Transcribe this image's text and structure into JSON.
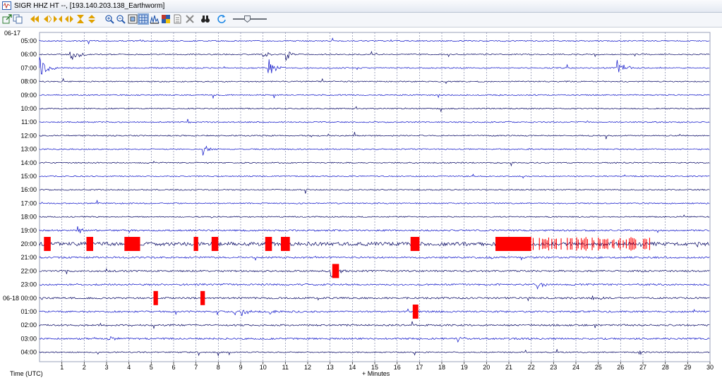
{
  "window": {
    "title": "SIGR HHZ HT --, [193.140.203.138_Earthworm]"
  },
  "toolbar": {
    "buttons": [
      {
        "name": "export-icon",
        "color": "#2e7d32"
      },
      {
        "name": "copy-icon",
        "color": "#4a6fa5"
      },
      {
        "name": "rewind-fast-icon",
        "color": "#e0a100"
      },
      {
        "name": "rewind-icon",
        "color": "#e0a100"
      },
      {
        "name": "shrink-icon",
        "color": "#e0a100"
      },
      {
        "name": "expand-icon",
        "color": "#e0a100"
      },
      {
        "name": "hourglass-icon",
        "color": "#e0a100"
      },
      {
        "name": "vertical-expand-icon",
        "color": "#e0a100"
      },
      {
        "name": "zoom-in-icon",
        "color": "#2a5db0"
      },
      {
        "name": "zoom-out-icon",
        "color": "#2a5db0"
      },
      {
        "name": "fit-page-icon",
        "color": "#444444"
      },
      {
        "name": "grid-view-icon",
        "color": "#2a5db0",
        "active": true
      },
      {
        "name": "spectrum-icon",
        "color": "#2a5db0"
      },
      {
        "name": "color-map-icon",
        "color": "#c0392b"
      },
      {
        "name": "page-icon",
        "color": "#777777"
      },
      {
        "name": "close-icon",
        "color": "#888888"
      },
      {
        "name": "binoculars-icon",
        "color": "#222222"
      },
      {
        "name": "refresh-icon",
        "color": "#1e88e5"
      }
    ],
    "zoom_level": 0.4
  },
  "helicorder": {
    "date_top": "06-17",
    "time_axis_label": "Time (UTC)",
    "minute_axis_label": "+ Minutes",
    "trace_color": "#0a10c8",
    "clip_color": "#ff0000",
    "grid_color": "#7f86a6",
    "hour_labels": [
      "05:00",
      "06:00",
      "07:00",
      "08:00",
      "09:00",
      "10:00",
      "11:00",
      "12:00",
      "13:00",
      "14:00",
      "15:00",
      "16:00",
      "17:00",
      "18:00",
      "19:00",
      "20:00",
      "21:00",
      "22:00",
      "23:00",
      "06-18 00:00",
      "01:00",
      "02:00",
      "03:00",
      "04:00"
    ],
    "minute_ticks": [
      "1",
      "2",
      "3",
      "4",
      "5",
      "6",
      "7",
      "8",
      "9",
      "10",
      "11",
      "12",
      "13",
      "14",
      "15",
      "16",
      "17",
      "18",
      "19",
      "20",
      "21",
      "22",
      "23",
      "24",
      "25",
      "26",
      "27",
      "28",
      "29",
      "30"
    ],
    "events": [
      {
        "row": 1,
        "min": 10.0,
        "amp": 0.5,
        "dur": 0.6
      },
      {
        "row": 2,
        "min": 0.0,
        "amp": 0.9,
        "dur": 0.8
      },
      {
        "row": 1,
        "min": 1.3,
        "amp": 0.9,
        "dur": 0.8
      },
      {
        "row": 2,
        "min": 10.2,
        "amp": 0.9,
        "dur": 0.8
      },
      {
        "row": 1,
        "min": 11.0,
        "amp": 0.6,
        "dur": 0.6
      },
      {
        "row": 2,
        "min": 25.8,
        "amp": 0.8,
        "dur": 0.9
      },
      {
        "row": 0,
        "min": 4.5,
        "amp": 0.15,
        "dur": 0.3
      },
      {
        "row": 8,
        "min": 7.3,
        "amp": 0.6,
        "dur": 0.7
      },
      {
        "row": 14,
        "min": 1.7,
        "amp": 0.5,
        "dur": 0.6
      },
      {
        "row": 6,
        "min": 6.6,
        "amp": 0.3,
        "dur": 0.3
      },
      {
        "row": 17,
        "min": 13.0,
        "amp": 0.7,
        "dur": 0.9
      },
      {
        "row": 18,
        "min": 22.2,
        "amp": 0.6,
        "dur": 0.6
      },
      {
        "row": 19,
        "min": 24.6,
        "amp": 0.3,
        "dur": 0.6
      },
      {
        "row": 20,
        "min": 9.0,
        "amp": 0.5,
        "dur": 0.7
      },
      {
        "row": 20,
        "min": 10.3,
        "amp": 0.3,
        "dur": 0.6
      },
      {
        "row": 22,
        "min": 18.7,
        "amp": 0.3,
        "dur": 0.5
      },
      {
        "row": 23,
        "min": 26.8,
        "amp": 0.35,
        "dur": 0.4
      },
      {
        "row": 22,
        "min": 3.0,
        "amp": 0.4,
        "dur": 0.6
      },
      {
        "row": 20,
        "min": 8.7,
        "amp": 0.4,
        "dur": 0.4
      }
    ],
    "clips": [
      {
        "row": 15,
        "min": 0.2,
        "w": 0.3
      },
      {
        "row": 15,
        "min": 2.1,
        "w": 0.3
      },
      {
        "row": 15,
        "min": 3.8,
        "w": 0.7
      },
      {
        "row": 15,
        "min": 6.9,
        "w": 0.2
      },
      {
        "row": 15,
        "min": 7.7,
        "w": 0.3
      },
      {
        "row": 15,
        "min": 10.1,
        "w": 0.3
      },
      {
        "row": 15,
        "min": 10.8,
        "w": 0.4
      },
      {
        "row": 15,
        "min": 16.6,
        "w": 0.4
      },
      {
        "row": 17,
        "min": 13.1,
        "w": 0.3
      },
      {
        "row": 19,
        "min": 5.1,
        "w": 0.2
      },
      {
        "row": 19,
        "min": 7.2,
        "w": 0.2
      },
      {
        "row": 20,
        "min": 16.7,
        "w": 0.25
      }
    ],
    "clip_burst": {
      "row": 15,
      "start": 20.4,
      "end": 27.4
    }
  }
}
